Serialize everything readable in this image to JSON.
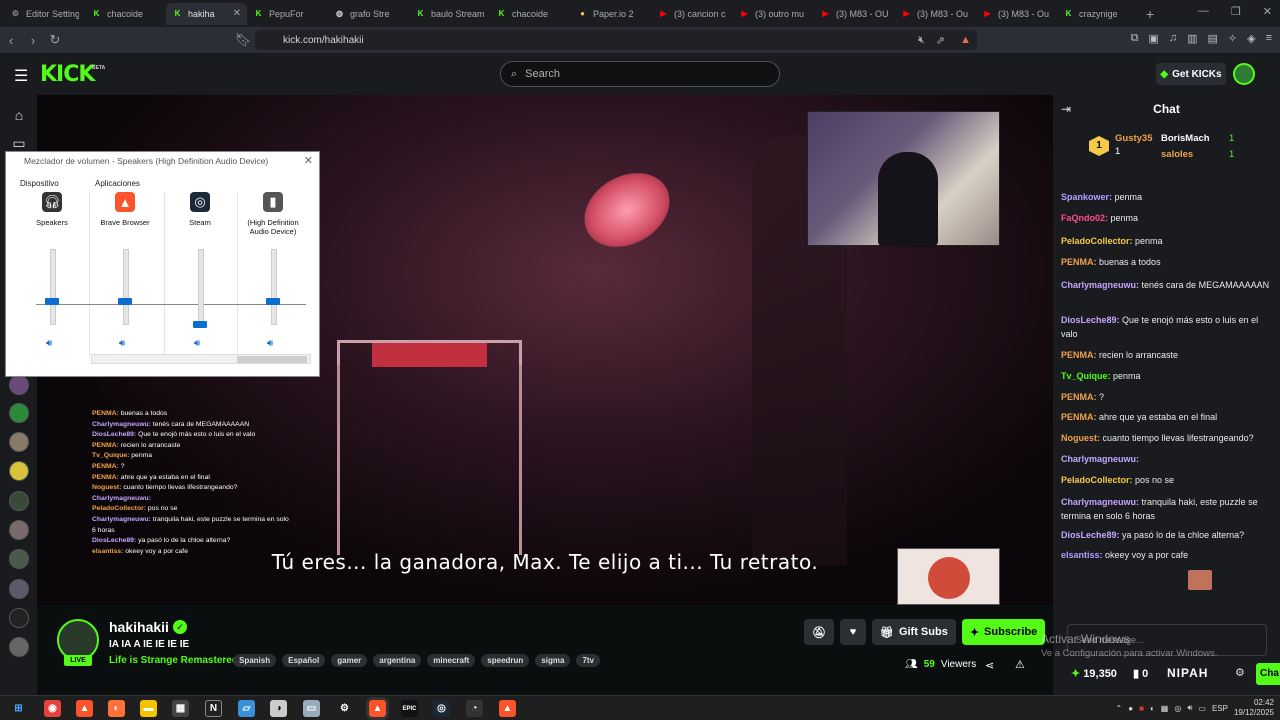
{
  "browser": {
    "tabs": [
      {
        "title": "Editor Settings",
        "icon": "gear-icon",
        "color": "#888888",
        "active": false
      },
      {
        "title": "chacoide",
        "icon": "kick-icon",
        "color": "#53fc18",
        "active": false
      },
      {
        "title": "hakiha",
        "icon": "kick-icon",
        "color": "#53fc18",
        "active": true
      },
      {
        "title": "PepuFor",
        "icon": "kick-icon",
        "color": "#53fc18",
        "active": false
      },
      {
        "title": "grafo Stre",
        "icon": "audio-icon",
        "color": "#cccccc",
        "active": false
      },
      {
        "title": "baulo Stream",
        "icon": "kick-icon",
        "color": "#53fc18",
        "active": false
      },
      {
        "title": "chacoide",
        "icon": "kick-icon",
        "color": "#53fc18",
        "active": false
      },
      {
        "title": "Paper.io 2",
        "icon": "paper-icon",
        "color": "#f4c542",
        "active": false
      },
      {
        "title": "(3) cancion c",
        "icon": "youtube-icon",
        "color": "#ff0000",
        "active": false
      },
      {
        "title": "(3) outro mu",
        "icon": "youtube-icon",
        "color": "#ff0000",
        "active": false
      },
      {
        "title": "(3) M83 - OU",
        "icon": "youtube-icon",
        "color": "#ff0000",
        "active": false
      },
      {
        "title": "(3) M83 - Ou",
        "icon": "youtube-icon",
        "color": "#ff0000",
        "active": false
      },
      {
        "title": "(3) M83 - Ou",
        "icon": "youtube-icon",
        "color": "#ff0000",
        "active": false
      },
      {
        "title": "crazynige",
        "icon": "kick-icon",
        "color": "#53fc18",
        "active": false
      }
    ],
    "url": "kick.com/hakihakii"
  },
  "kick": {
    "logo": "KICK",
    "beta": "BETA",
    "search_placeholder": "Search",
    "get_kicks": "Get KICKs"
  },
  "video": {
    "subtitle": "Tú eres...  la ganadora, Max.  Te elijo a ti...  Tu retrato."
  },
  "overlay_chat": [
    {
      "user": "PENMA:",
      "text": "buenas a todos",
      "cls": "u"
    },
    {
      "user": "Charlymagneuwu:",
      "text": "tenés cara de MEGAMAAAAAN",
      "cls": "u2"
    },
    {
      "user": "DiosLeche89:",
      "text": "Que te enojó más esto o luis en el valo",
      "cls": "u2"
    },
    {
      "user": "PENMA:",
      "text": "recien lo arrancaste",
      "cls": "u"
    },
    {
      "user": "Tv_Quique:",
      "text": "penma",
      "cls": "u"
    },
    {
      "user": "PENMA:",
      "text": "?",
      "cls": "u"
    },
    {
      "user": "PENMA:",
      "text": "ahre que ya estaba en el final",
      "cls": "u"
    },
    {
      "user": "Noguest:",
      "text": "cuanto tiempo llevas lifestrangeando?",
      "cls": "u"
    },
    {
      "user": "Charlymagneuwu:",
      "text": "",
      "cls": "u2"
    },
    {
      "user": "PeladoCollector:",
      "text": "pos no se",
      "cls": "u"
    },
    {
      "user": "Charlymagneuwu:",
      "text": "tranquila haki, este puzzle se termina en solo 6 horas",
      "cls": "u2"
    },
    {
      "user": "DiosLeche89:",
      "text": "ya pasó lo de la chloe alterna?",
      "cls": "u2"
    },
    {
      "user": "elsantiss:",
      "text": "okeey voy a por cafe",
      "cls": "u"
    }
  ],
  "mixer": {
    "title": "Mezclador de volumen - Speakers (High Definition Audio Device)",
    "device_label": "Dispositivo",
    "apps_label": "Aplicaciones",
    "columns": [
      {
        "name": "Speakers",
        "icon": "headphones-icon",
        "level": 0.3
      },
      {
        "name": "Brave Browser",
        "icon": "brave-icon",
        "level": 0.3
      },
      {
        "name": "Steam",
        "icon": "steam-icon",
        "level": 0.0
      },
      {
        "name": "(High Definition Audio Device)",
        "icon": "speaker-device-icon",
        "level": 0.3
      }
    ]
  },
  "chat": {
    "title": "Chat",
    "leaderboard": [
      {
        "rank": "1",
        "name": "Gusty35",
        "count": "1"
      },
      {
        "rank": "",
        "name": "BorisMach",
        "count": "1"
      },
      {
        "rank": "",
        "name": "saloles",
        "count": "1"
      }
    ],
    "messages": [
      {
        "user": "Spankower:",
        "text": "penma",
        "color": "#b69cff"
      },
      {
        "user": "FaQndo02:",
        "text": "penma",
        "color": "#ff4f8b"
      },
      {
        "user": "PeladoCollector:",
        "text": "penma",
        "color": "#f7c948"
      },
      {
        "user": "PENMA:",
        "text": "buenas a todos",
        "color": "#f0a24b"
      },
      {
        "user": "Charlymagneuwu:",
        "text": "tenés cara de MEGAMAAAAAN",
        "color": "#c3a6ff"
      },
      {
        "user": "DiosLeche89:",
        "text": "Que te enojó más esto o luis en el valo",
        "color": "#c3a6ff"
      },
      {
        "user": "PENMA:",
        "text": "recien lo arrancaste",
        "color": "#f0a24b"
      },
      {
        "user": "Tv_Quique:",
        "text": "penma",
        "color": "#53fc18"
      },
      {
        "user": "PENMA:",
        "text": "?",
        "color": "#f0a24b"
      },
      {
        "user": "PENMA:",
        "text": "ahre que ya estaba en el final",
        "color": "#f0a24b"
      },
      {
        "user": "Noguest:",
        "text": "cuanto tiempo llevas lifestrangeando?",
        "color": "#f0a24b"
      },
      {
        "user": "Charlymagneuwu:",
        "text": "",
        "color": "#c3a6ff"
      },
      {
        "user": "PeladoCollector:",
        "text": "pos no se",
        "color": "#f7c948"
      },
      {
        "user": "Charlymagneuwu:",
        "text": "tranquila haki, este puzzle se termina en solo 6 horas",
        "color": "#c3a6ff"
      },
      {
        "user": "DiosLeche89:",
        "text": "ya pasó lo de la chloe alterna?",
        "color": "#c3a6ff"
      },
      {
        "user": "elsantiss:",
        "text": "okeey voy a por cafe",
        "color": "#b69cff"
      }
    ],
    "input_placeholder": "Send message...",
    "points": "19,350",
    "zero": "0",
    "nipah": "NIPAH",
    "chat_button": "Cha"
  },
  "windows_activation": {
    "line1": "Activar Windows",
    "line2": "Ve a Configuración para activar Windows."
  },
  "stream": {
    "name": "hakihakii",
    "title": "IA IA A IE IE IE IE",
    "category": "Life is Strange Remastered",
    "live": "LIVE",
    "tags": [
      "Spanish",
      "Español",
      "gamer",
      "argentina",
      "minecraft",
      "speedrun",
      "sigma",
      "7tv"
    ],
    "gift_subs": "Gift Subs",
    "subscribe": "Subscribe",
    "viewers_count": "59",
    "viewers_label": "Viewers"
  },
  "taskbar": {
    "lang": "ESP",
    "time": "02:42",
    "date": "19/12/2025"
  }
}
